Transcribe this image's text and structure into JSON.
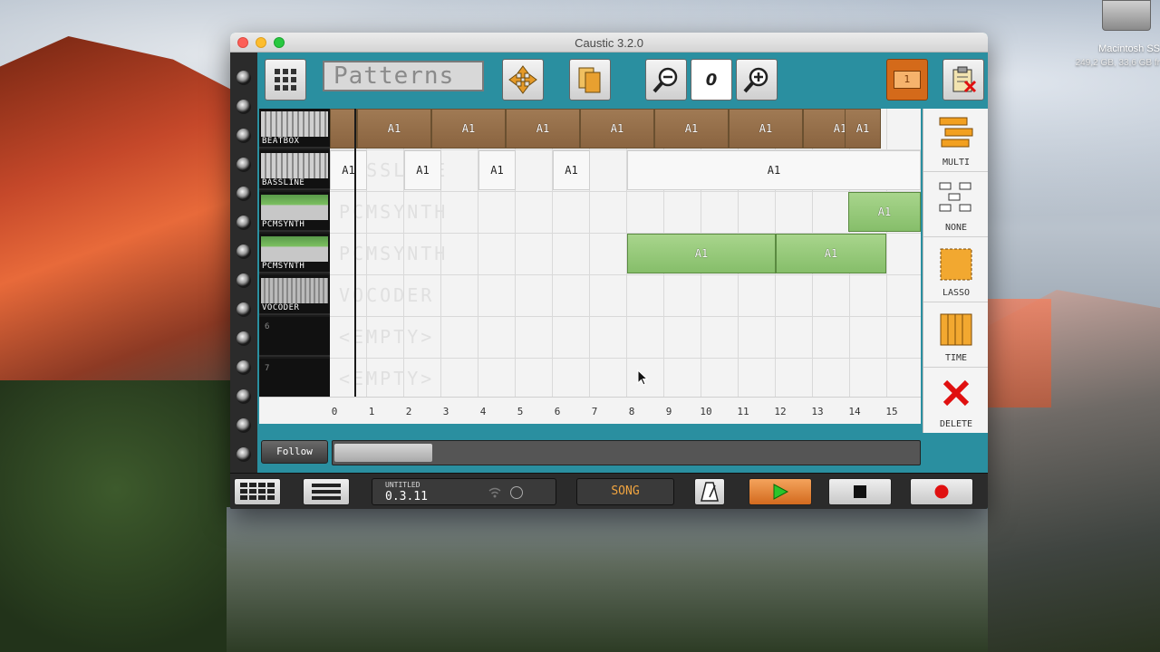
{
  "window": {
    "title": "Caustic 3.2.0"
  },
  "desktop": {
    "disk_name": "Macintosh SS",
    "disk_info": "249,2 GB, 33,6 GB fr"
  },
  "toolbar": {
    "view_field": "Patterns",
    "zoom_level": "0",
    "page_label": "1"
  },
  "tracks": [
    {
      "name": "BEATBOX",
      "kind": "beat"
    },
    {
      "name": "BASSLINE",
      "kind": "beat"
    },
    {
      "name": "PCMSYNTH",
      "kind": "synth"
    },
    {
      "name": "PCMSYNTH",
      "kind": "synth"
    },
    {
      "name": "VOCODER",
      "kind": "vocoder"
    },
    {
      "name": "",
      "number": "6",
      "kind": "empty"
    },
    {
      "name": "",
      "number": "7",
      "kind": "empty"
    }
  ],
  "ghost_labels": [
    "BASSLINE",
    "PCMSYNTH",
    "PCMSYNTH",
    "VOCODER",
    "<EMPTY>",
    "<EMPTY>"
  ],
  "patterns": {
    "beatbox": [
      "A1",
      "A1",
      "A1",
      "A1",
      "A1",
      "A1",
      "A1",
      "A1"
    ],
    "bassline": [
      "A1",
      "A1",
      "A1",
      "A1",
      "A1"
    ],
    "pcmsynth1": [
      "A1"
    ],
    "pcmsynth2": [
      "A1",
      "A1"
    ]
  },
  "steps": [
    "0",
    "1",
    "2",
    "3",
    "4",
    "5",
    "6",
    "7",
    "8",
    "9",
    "10",
    "11",
    "12",
    "13",
    "14",
    "15"
  ],
  "follow_label": "Follow",
  "tools": [
    {
      "label": "MULTI"
    },
    {
      "label": "NONE"
    },
    {
      "label": "LASSO"
    },
    {
      "label": "TIME"
    },
    {
      "label": "DELETE"
    }
  ],
  "transport": {
    "song_name": "UNTITLED",
    "song_time": "0.3.11",
    "mode": "SONG"
  },
  "colors": {
    "window_bg": "#2a8fa0",
    "beat_pattern": "#8a6440",
    "synth_pattern": "#86be6a",
    "play_button": "#d36a1e",
    "record_dot": "#e01010",
    "delete_x": "#e01010"
  }
}
